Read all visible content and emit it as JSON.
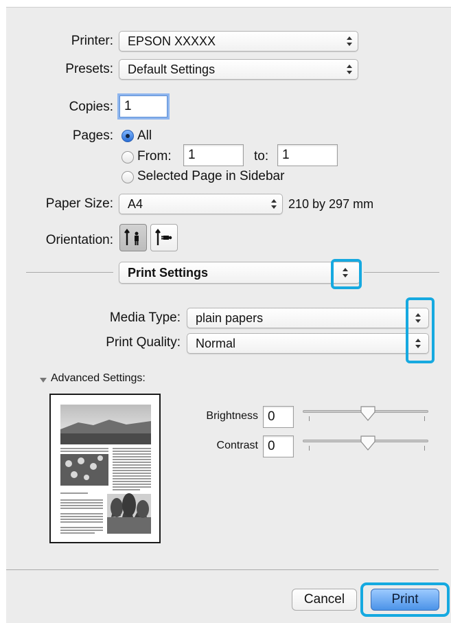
{
  "printer": {
    "label": "Printer:",
    "value": "EPSON XXXXX"
  },
  "presets": {
    "label": "Presets:",
    "value": "Default Settings"
  },
  "copies": {
    "label": "Copies:",
    "value": "1"
  },
  "pages": {
    "label": "Pages:",
    "all_label": "All",
    "from_label": "From:",
    "from_value": "1",
    "to_label": "to:",
    "to_value": "1",
    "sidebar_label": "Selected Page in Sidebar",
    "selected": "All"
  },
  "paper_size": {
    "label": "Paper Size:",
    "value": "A4",
    "dimensions": "210 by 297 mm"
  },
  "orientation": {
    "label": "Orientation:",
    "selected": "portrait"
  },
  "section": {
    "value": "Print Settings"
  },
  "media_type": {
    "label": "Media Type:",
    "value": "plain papers"
  },
  "print_quality": {
    "label": "Print Quality:",
    "value": "Normal"
  },
  "advanced": {
    "label": "Advanced Settings:"
  },
  "brightness": {
    "label": "Brightness",
    "value": "0",
    "slider_fraction": 0.5
  },
  "contrast": {
    "label": "Contrast",
    "value": "0",
    "slider_fraction": 0.5
  },
  "buttons": {
    "cancel": "Cancel",
    "print": "Print"
  },
  "colors": {
    "highlight": "#16a9e0",
    "accent": "#4b93e8"
  }
}
